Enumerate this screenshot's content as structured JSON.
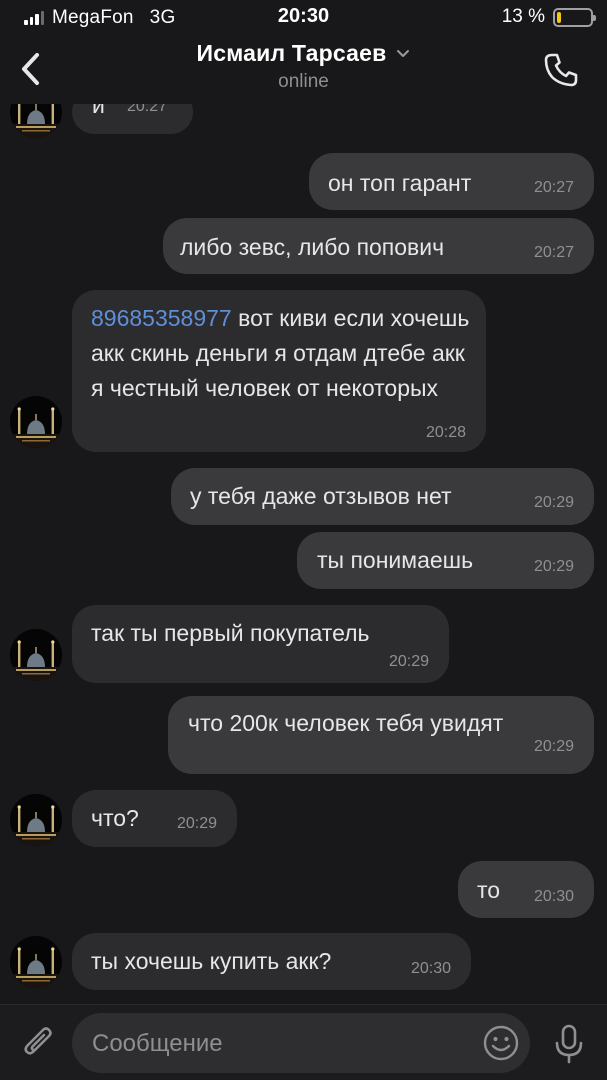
{
  "status_bar": {
    "carrier": "MegaFon",
    "network": "3G",
    "time": "20:30",
    "battery_text": "13 %",
    "battery_level": 0.13,
    "battery_color": "#f5c518"
  },
  "header": {
    "contact_name": "Исмаил Тарсаев",
    "status": "online",
    "back_icon": "chevron-left-icon",
    "dropdown_icon": "chevron-down-icon",
    "call_icon": "phone-icon"
  },
  "messages": [
    {
      "direction": "in",
      "text": "и",
      "time": "20:27"
    },
    {
      "direction": "out",
      "text": "он топ гарант",
      "time": "20:27"
    },
    {
      "direction": "out",
      "text": "либо зевс, либо попович",
      "time": "20:27"
    },
    {
      "direction": "in",
      "phone": "89685358977",
      "text": " вот киви если хочешь акк скинь деньги я отдам дтебе акк я честный человек от некоторых",
      "time": "20:28"
    },
    {
      "direction": "out",
      "text": "у тебя даже отзывов нет",
      "time": "20:29"
    },
    {
      "direction": "out",
      "text": "ты понимаешь",
      "time": "20:29"
    },
    {
      "direction": "in",
      "text": "так ты первый покупатель",
      "time": "20:29"
    },
    {
      "direction": "out",
      "text": "что 200к человек тебя увидят",
      "time": "20:29"
    },
    {
      "direction": "in",
      "text": "что?",
      "time": "20:29"
    },
    {
      "direction": "out",
      "text": "то",
      "time": "20:30"
    },
    {
      "direction": "in",
      "text": "ты хочешь купить акк?",
      "time": "20:30"
    }
  ],
  "input": {
    "placeholder": "Сообщение",
    "attach_icon": "paperclip-icon",
    "emoji_icon": "emoji-icon",
    "mic_icon": "microphone-icon"
  },
  "colors": {
    "background": "#18181a",
    "bubble_out": "#3a3a3c",
    "bubble_in": "#2c2c2e",
    "link": "#5f8fd6"
  }
}
